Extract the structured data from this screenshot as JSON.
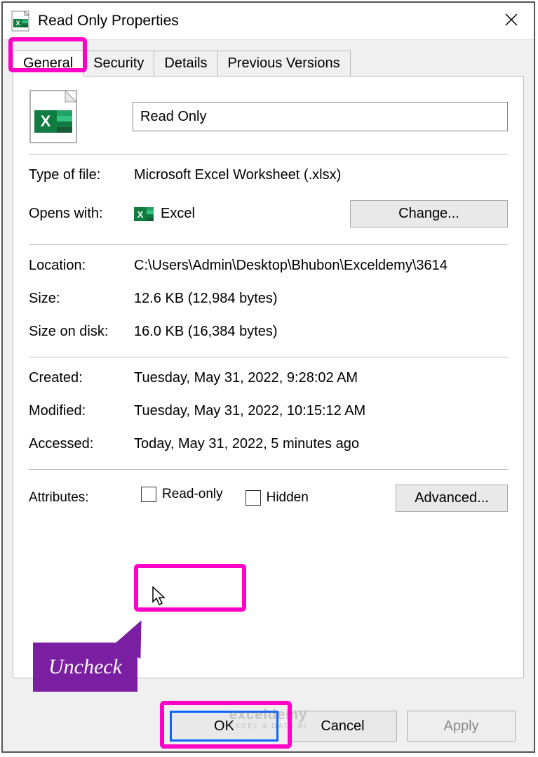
{
  "window": {
    "title": "Read Only Properties"
  },
  "tabs": {
    "general": "General",
    "security": "Security",
    "details": "Details",
    "previous": "Previous Versions"
  },
  "file": {
    "name": "Read Only"
  },
  "fields": {
    "type_label": "Type of file:",
    "type_value": "Microsoft Excel Worksheet (.xlsx)",
    "opens_label": "Opens with:",
    "opens_value": "Excel",
    "change_btn": "Change...",
    "location_label": "Location:",
    "location_value": "C:\\Users\\Admin\\Desktop\\Bhubon\\Exceldemy\\3614",
    "size_label": "Size:",
    "size_value": "12.6 KB (12,984 bytes)",
    "sizeondisk_label": "Size on disk:",
    "sizeondisk_value": "16.0 KB (16,384 bytes)",
    "created_label": "Created:",
    "created_value": "Tuesday, May 31, 2022, 9:28:02 AM",
    "modified_label": "Modified:",
    "modified_value": "Tuesday, May 31, 2022, 10:15:12 AM",
    "accessed_label": "Accessed:",
    "accessed_value": "Today, May 31, 2022, 5 minutes ago",
    "attributes_label": "Attributes:",
    "readonly_label": "Read-only",
    "hidden_label": "Hidden",
    "advanced_btn": "Advanced..."
  },
  "callout": {
    "text": "Uncheck"
  },
  "buttons": {
    "ok": "OK",
    "cancel": "Cancel",
    "apply": "Apply"
  },
  "watermark": {
    "main": "exceldemy",
    "sub": "EXCEL & DATA BI"
  }
}
